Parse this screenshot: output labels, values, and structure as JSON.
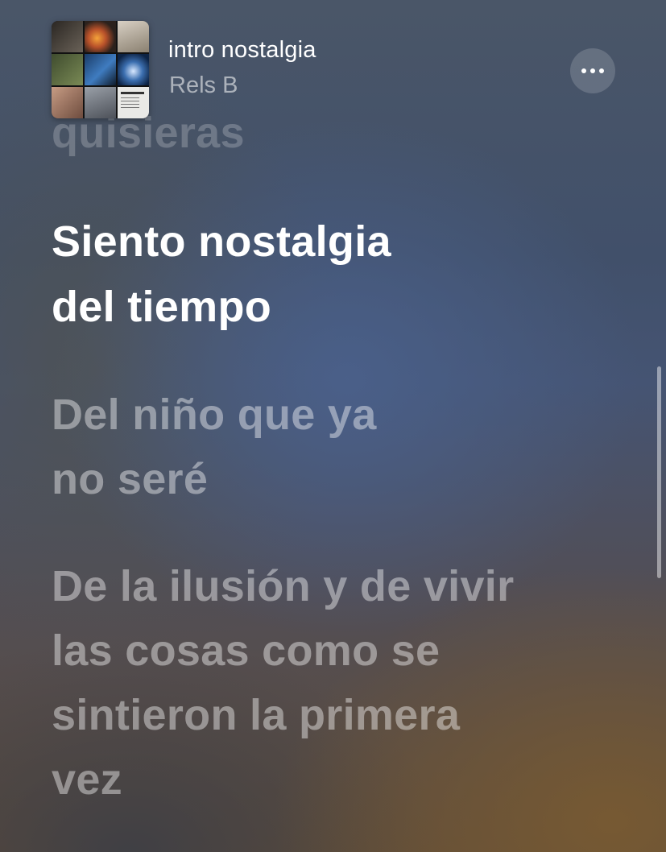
{
  "now_playing": {
    "title": "intro nostalgia",
    "artist": "Rels B",
    "more_button_icon": "ellipsis-icon"
  },
  "lyrics": {
    "previous_fragment": "quisieras",
    "active": [
      "Siento nostalgia",
      "del tiempo"
    ],
    "next_1": [
      "Del niño que ya",
      "no seré"
    ],
    "next_2": [
      "De la ilusión y de vivir",
      "las cosas como se",
      "sintieron la primera",
      "vez"
    ]
  }
}
